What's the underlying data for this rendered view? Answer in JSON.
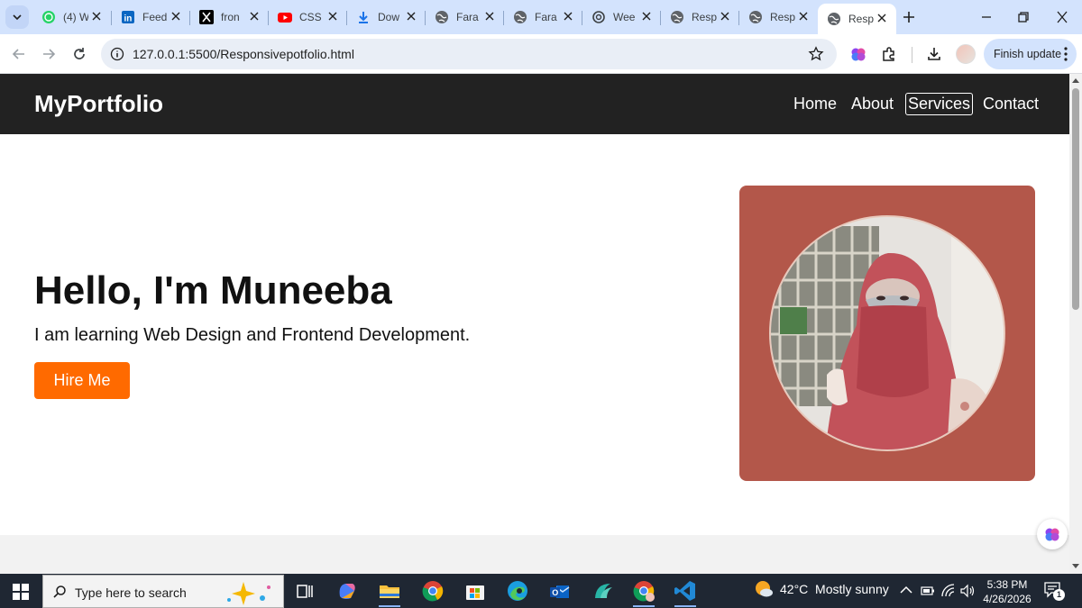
{
  "browser": {
    "tabs": [
      {
        "title": "(4) W",
        "icon": "whatsapp-icon",
        "color": "#25d366"
      },
      {
        "title": "Feed",
        "icon": "linkedin-icon",
        "color": "#0a66c2"
      },
      {
        "title": "fron",
        "icon": "x-icon",
        "color": "#000000"
      },
      {
        "title": "CSS",
        "icon": "youtube-icon",
        "color": "#ff0000"
      },
      {
        "title": "Dow",
        "icon": "download-icon",
        "color": "#1a73e8"
      },
      {
        "title": "Fara",
        "icon": "globe-icon",
        "color": "#5f6368"
      },
      {
        "title": "Fara",
        "icon": "globe-icon",
        "color": "#5f6368"
      },
      {
        "title": "Wee",
        "icon": "openai-icon",
        "color": "#3c4043"
      },
      {
        "title": "Resp",
        "icon": "globe-icon",
        "color": "#5f6368"
      },
      {
        "title": "Resp",
        "icon": "globe-icon",
        "color": "#5f6368"
      },
      {
        "title": "Resp",
        "icon": "globe-icon",
        "color": "#5f6368",
        "active": true
      }
    ],
    "url": "127.0.0.1:5500/Responsivepotfolio.html",
    "finish_update_label": "Finish update"
  },
  "page": {
    "logo": "MyPortfolio",
    "nav": [
      "Home",
      "About",
      "Services",
      "Contact"
    ],
    "hero_title": "Hello, I'm Muneeba",
    "hero_subtitle": "I am learning Web Design and Frontend Development.",
    "cta_label": "Hire Me",
    "colors": {
      "navbar": "#222222",
      "cta": "#ff6a00",
      "photo_card": "#b3574a"
    }
  },
  "taskbar": {
    "search_placeholder": "Type here to search",
    "weather": "42°C  Mostly sunny",
    "time": "5:38 PM",
    "date": "4/26/2026",
    "notification_count": "1"
  }
}
